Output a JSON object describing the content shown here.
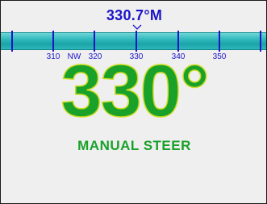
{
  "heading": {
    "readout": "330.7°M"
  },
  "compass_tape": {
    "labels": [
      {
        "text": "310"
      },
      {
        "text": "NW"
      },
      {
        "text": "320"
      },
      {
        "text": "330"
      },
      {
        "text": "340"
      },
      {
        "text": "350"
      }
    ]
  },
  "display": {
    "big_heading": "330°",
    "mode": "MANUAL STEER"
  },
  "colors": {
    "accent": "#1b14c8",
    "tape": "#2fb8bb",
    "heading_green": "#1aa12a",
    "background": "#efefef"
  }
}
